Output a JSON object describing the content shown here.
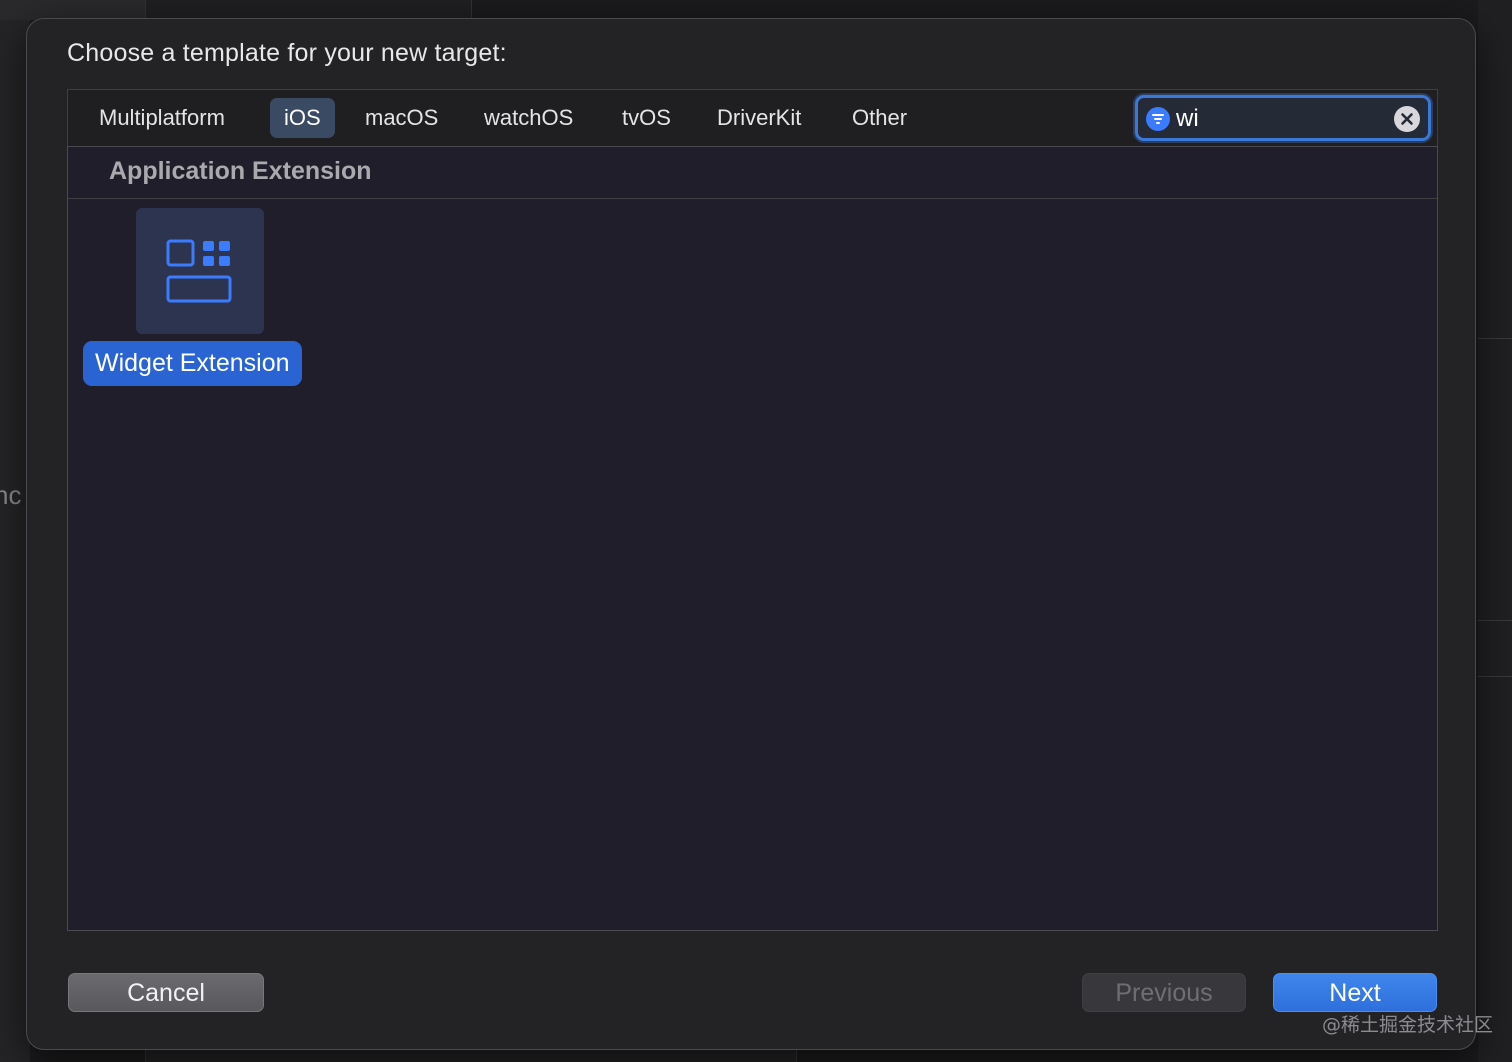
{
  "background": {
    "left_partial_text": "nc"
  },
  "dialog": {
    "title": "Choose a template for your new target:"
  },
  "tabs": [
    {
      "label": "Multiplatform",
      "selected": false
    },
    {
      "label": "iOS",
      "selected": true
    },
    {
      "label": "macOS",
      "selected": false
    },
    {
      "label": "watchOS",
      "selected": false
    },
    {
      "label": "tvOS",
      "selected": false
    },
    {
      "label": "DriverKit",
      "selected": false
    },
    {
      "label": "Other",
      "selected": false
    }
  ],
  "search": {
    "value": "wi",
    "filter_icon": "filter-icon",
    "clear_icon": "clear-icon"
  },
  "section": {
    "title": "Application Extension"
  },
  "templates": [
    {
      "label": "Widget Extension",
      "icon": "widget-icon",
      "selected": true
    }
  ],
  "buttons": {
    "cancel": "Cancel",
    "previous": "Previous",
    "next": "Next",
    "previous_enabled": false
  },
  "watermark": "@稀土掘金技术社区",
  "colors": {
    "accent": "#2a64d2",
    "selected_tab": "#3b4a63",
    "icon_blue": "#3b7cff"
  }
}
